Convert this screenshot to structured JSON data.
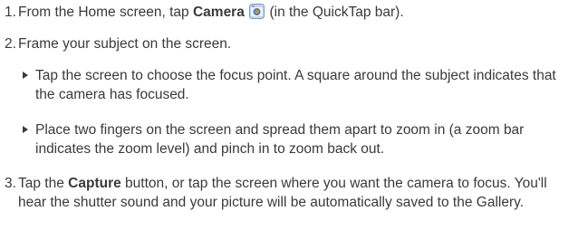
{
  "steps": [
    {
      "num": "1.",
      "pre": "From the Home screen, tap ",
      "bold": "Camera",
      "icon": "camera-app-icon",
      "post": " (in the QuickTap bar)."
    },
    {
      "num": "2.",
      "text": "Frame your subject on the screen.",
      "bullets": [
        "Tap the screen to choose the focus point. A square around the subject indicates that the camera has focused.",
        "Place two fingers on the screen and spread them apart to zoom in (a zoom bar indicates the zoom level) and pinch in to zoom back out."
      ]
    },
    {
      "num": "3.",
      "pre": "Tap the ",
      "bold": "Capture",
      "post": " button, or tap the screen where you want the camera to focus. You'll hear the shutter sound and your picture will be automatically saved to the Gallery."
    }
  ],
  "colors": {
    "text": "#3a3a3a",
    "icon_blue": "#3f87c8",
    "icon_orange": "#f08a1c"
  }
}
